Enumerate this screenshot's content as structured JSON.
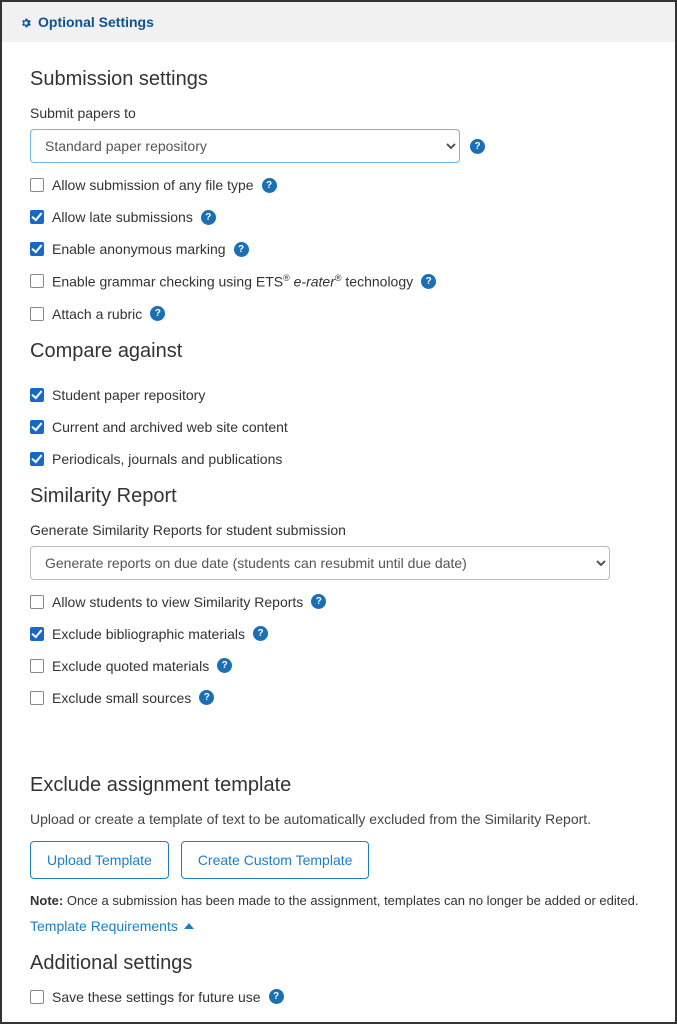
{
  "header": {
    "title": "Optional Settings"
  },
  "submission": {
    "heading": "Submission settings",
    "submit_label": "Submit papers to",
    "submit_select": "Standard paper repository",
    "allow_any_filetype": {
      "label": "Allow submission of any file type",
      "checked": false
    },
    "allow_late": {
      "label": "Allow late submissions",
      "checked": true
    },
    "anon_marking": {
      "label": "Enable anonymous marking",
      "checked": true
    },
    "grammar": {
      "prefix": "Enable grammar checking using ETS",
      "erater": "e-rater",
      "suffix": "technology",
      "checked": false
    },
    "attach_rubric": {
      "label": "Attach a rubric",
      "checked": false
    }
  },
  "compare": {
    "heading": "Compare against",
    "student_repo": {
      "label": "Student paper repository",
      "checked": true
    },
    "web_content": {
      "label": "Current and archived web site content",
      "checked": true
    },
    "periodicals": {
      "label": "Periodicals, journals and publications",
      "checked": true
    }
  },
  "similarity": {
    "heading": "Similarity Report",
    "generate_label": "Generate Similarity Reports for student submission",
    "generate_select": "Generate reports on due date (students can resubmit until due date)",
    "allow_view": {
      "label": "Allow students to view Similarity Reports",
      "checked": false
    },
    "excl_biblio": {
      "label": "Exclude bibliographic materials",
      "checked": true
    },
    "excl_quoted": {
      "label": "Exclude quoted materials",
      "checked": false
    },
    "excl_small": {
      "label": "Exclude small sources",
      "checked": false
    }
  },
  "exclude_template": {
    "heading": "Exclude assignment template",
    "desc": "Upload or create a template of text to be automatically excluded from the Similarity Report.",
    "upload_btn": "Upload Template",
    "create_btn": "Create Custom Template",
    "note_prefix": "Note:",
    "note_body": " Once a submission has been made to the assignment, templates can no longer be added or edited.",
    "requirements_link": "Template Requirements"
  },
  "additional": {
    "heading": "Additional settings",
    "save_future": {
      "label": "Save these settings for future use",
      "checked": false
    }
  }
}
